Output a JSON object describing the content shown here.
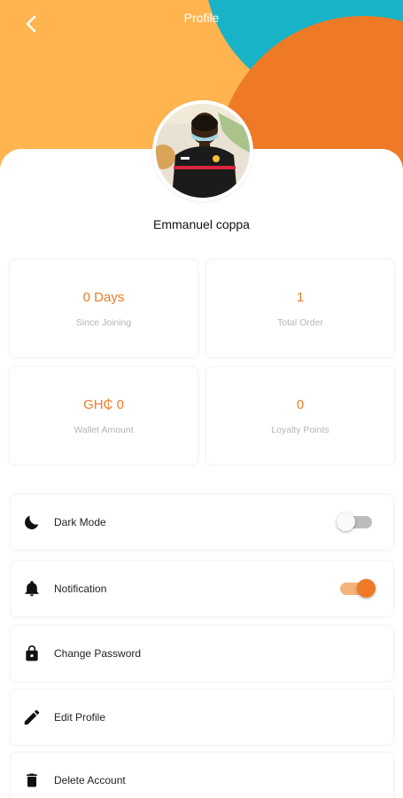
{
  "header": {
    "title": "Profile",
    "colors": {
      "base": "#ffb44f",
      "teal": "#18b3c6",
      "orange": "#ef7a25"
    }
  },
  "profile": {
    "name": "Emmanuel coppa"
  },
  "stats": [
    {
      "value": "0 Days",
      "label": "Since Joining"
    },
    {
      "value": "1",
      "label": "Total Order"
    },
    {
      "value": "GH₵ 0",
      "label": "Wallet Amount"
    },
    {
      "value": "0",
      "label": "Loyalty Points"
    }
  ],
  "settings": [
    {
      "label": "Dark Mode",
      "icon": "moon-icon",
      "toggle": false
    },
    {
      "label": "Notification",
      "icon": "bell-icon",
      "toggle": true
    },
    {
      "label": "Change Password",
      "icon": "lock-icon"
    },
    {
      "label": "Edit Profile",
      "icon": "pencil-icon"
    },
    {
      "label": "Delete Account",
      "icon": "trash-icon"
    }
  ],
  "accent": "#ef7a25"
}
